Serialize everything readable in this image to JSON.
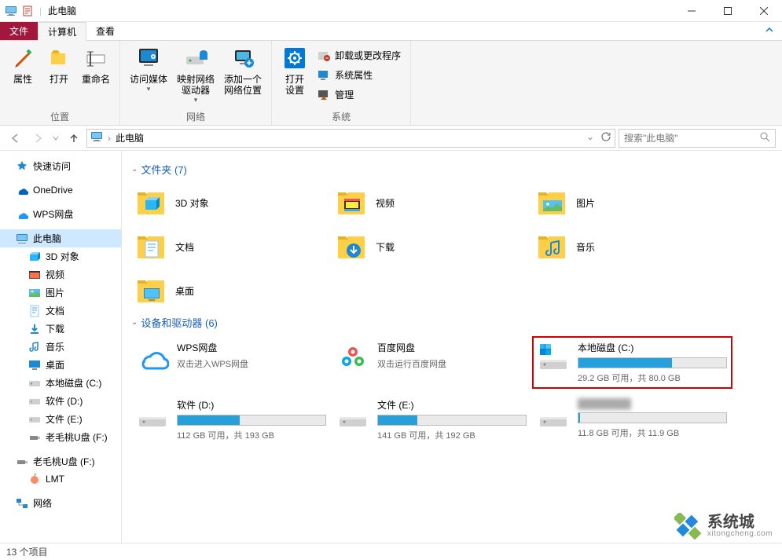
{
  "titlebar": {
    "title": "此电脑"
  },
  "menutabs": {
    "file": "文件",
    "computer": "计算机",
    "view": "查看"
  },
  "ribbon": {
    "g1": {
      "properties": "属性",
      "open": "打开",
      "rename": "重命名",
      "label": "位置"
    },
    "g2": {
      "access_media": "访问媒体",
      "map_drive": "映射网络\n驱动器",
      "add_loc": "添加一个\n网络位置",
      "label": "网络"
    },
    "g3": {
      "open_settings": "打开\n设置",
      "uninstall": "卸载或更改程序",
      "sys_props": "系统属性",
      "manage": "管理",
      "label": "系统"
    }
  },
  "addr": {
    "location": "此电脑",
    "search_placeholder": "搜索\"此电脑\""
  },
  "nav": {
    "quick": "快速访问",
    "onedrive": "OneDrive",
    "wps": "WPS网盘",
    "thispc": "此电脑",
    "sub": [
      "3D 对象",
      "视频",
      "图片",
      "文档",
      "下载",
      "音乐",
      "桌面",
      "本地磁盘 (C:)",
      "软件 (D:)",
      "文件 (E:)",
      "老毛桃U盘 (F:)"
    ],
    "lmt_usb": "老毛桃U盘 (F:)",
    "lmt": "LMT",
    "network": "网络"
  },
  "content": {
    "folders_header": "文件夹 (7)",
    "drives_header": "设备和驱动器 (6)",
    "folders": [
      "3D 对象",
      "视频",
      "图片",
      "文档",
      "下载",
      "音乐",
      "桌面"
    ],
    "cloud": [
      {
        "name": "WPS网盘",
        "sub": "双击进入WPS网盘"
      },
      {
        "name": "百度网盘",
        "sub": "双击运行百度网盘"
      }
    ],
    "drives": [
      {
        "name": "本地磁盘 (C:)",
        "stats": "29.2 GB 可用，共 80.0 GB",
        "used_pct": 63.5,
        "highlight": true
      },
      {
        "name": "软件 (D:)",
        "stats": "112 GB 可用，共 193 GB",
        "used_pct": 42
      },
      {
        "name": "文件 (E:)",
        "stats": "141 GB 可用，共 192 GB",
        "used_pct": 26.6
      },
      {
        "name": "",
        "stats": "11.8 GB 可用，共 11.9 GB",
        "used_pct": 1,
        "blurred_name": true
      }
    ]
  },
  "statusbar": {
    "items": "13 个项目"
  },
  "watermark": {
    "title": "系统城",
    "sub": "xitongcheng.com"
  }
}
